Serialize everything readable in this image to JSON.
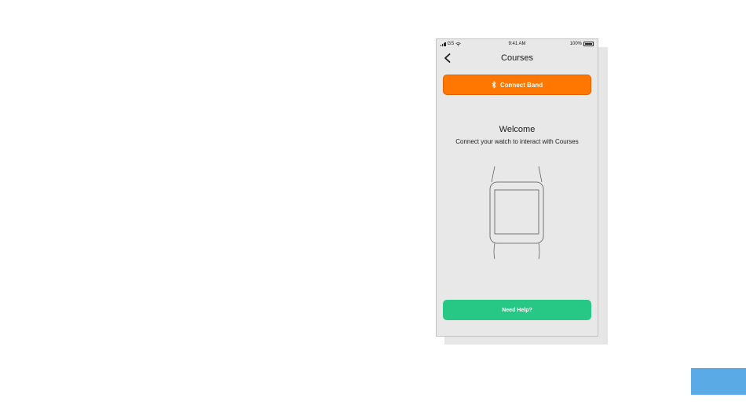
{
  "status_bar": {
    "carrier": "GS",
    "time": "9:41 AM",
    "battery": "100%"
  },
  "nav": {
    "title": "Courses",
    "back_icon": "chevron-left-icon"
  },
  "connect_button": {
    "label": "Connect Band",
    "icon": "bluetooth-icon",
    "color": "#ff7600"
  },
  "welcome": {
    "title": "Welcome",
    "subtitle": "Connect your watch to interact with Courses"
  },
  "illustration": {
    "icon": "smartwatch-icon"
  },
  "help_button": {
    "label": "Need Help?",
    "color": "#27c785"
  },
  "colors": {
    "screen_background": "#e8e8e8",
    "accent_tab": "#5aaae5"
  }
}
